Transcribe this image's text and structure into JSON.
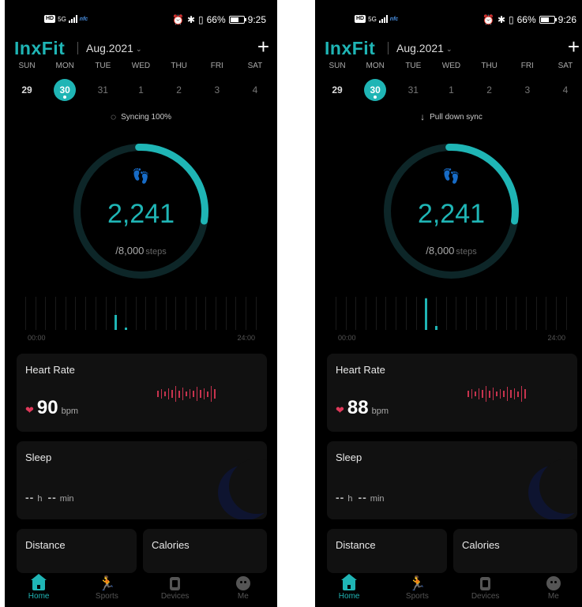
{
  "colors": {
    "accent": "#1fb5b5",
    "heart": "#e0395a",
    "background": "#000000",
    "card": "#111111"
  },
  "screens": [
    {
      "status": {
        "network": "5G",
        "battery": "66%",
        "time": "9:25"
      },
      "header": {
        "logo": "InxFit",
        "month": "Aug.2021",
        "add_icon": "plus-icon"
      },
      "week": [
        {
          "name": "SUN",
          "date": "29"
        },
        {
          "name": "MON",
          "date": "30"
        },
        {
          "name": "TUE",
          "date": "31"
        },
        {
          "name": "WED",
          "date": "1"
        },
        {
          "name": "THU",
          "date": "2"
        },
        {
          "name": "FRI",
          "date": "3"
        },
        {
          "name": "SAT",
          "date": "4"
        }
      ],
      "sync": {
        "icon": "syncing-spinner-icon",
        "text": "Syncing 100%"
      },
      "steps": {
        "value": "2,241",
        "goal": "/8,000",
        "unit": "steps",
        "progress_fraction": 0.28
      },
      "hourly": {
        "start": "00:00",
        "end": "24:00",
        "levels": [
          0,
          0,
          0,
          0,
          0,
          0,
          0,
          0,
          0,
          0.45,
          0.08,
          0,
          0,
          0,
          0,
          0,
          0,
          0,
          0,
          0,
          0,
          0,
          0,
          0
        ]
      },
      "heart_rate": {
        "title": "Heart Rate",
        "value": "90",
        "unit": "bpm"
      },
      "sleep": {
        "title": "Sleep",
        "hours": "--",
        "h": "h",
        "minutes": "--",
        "min": "min"
      },
      "distance": {
        "title": "Distance"
      },
      "calories": {
        "title": "Calories"
      },
      "nav": [
        {
          "label": "Home",
          "icon": "home-icon"
        },
        {
          "label": "Sports",
          "icon": "running-icon"
        },
        {
          "label": "Devices",
          "icon": "watch-icon"
        },
        {
          "label": "Me",
          "icon": "face-icon"
        }
      ]
    },
    {
      "status": {
        "network": "5G",
        "battery": "66%",
        "time": "9:26"
      },
      "header": {
        "logo": "InxFit",
        "month": "Aug.2021",
        "add_icon": "plus-icon"
      },
      "week": [
        {
          "name": "SUN",
          "date": "29"
        },
        {
          "name": "MON",
          "date": "30"
        },
        {
          "name": "TUE",
          "date": "31"
        },
        {
          "name": "WED",
          "date": "1"
        },
        {
          "name": "THU",
          "date": "2"
        },
        {
          "name": "FRI",
          "date": "3"
        },
        {
          "name": "SAT",
          "date": "4"
        }
      ],
      "sync": {
        "icon": "arrow-down-icon",
        "text": "Pull down sync"
      },
      "steps": {
        "value": "2,241",
        "goal": "/8,000",
        "unit": "steps",
        "progress_fraction": 0.28
      },
      "hourly": {
        "start": "00:00",
        "end": "24:00",
        "levels": [
          0,
          0,
          0,
          0,
          0,
          0,
          0,
          0,
          0,
          0.95,
          0.12,
          0,
          0,
          0,
          0,
          0,
          0,
          0,
          0,
          0,
          0,
          0,
          0,
          0
        ]
      },
      "heart_rate": {
        "title": "Heart Rate",
        "value": "88",
        "unit": "bpm"
      },
      "sleep": {
        "title": "Sleep",
        "hours": "--",
        "h": "h",
        "minutes": "--",
        "min": "min"
      },
      "distance": {
        "title": "Distance"
      },
      "calories": {
        "title": "Calories"
      },
      "nav": [
        {
          "label": "Home",
          "icon": "home-icon"
        },
        {
          "label": "Sports",
          "icon": "running-icon"
        },
        {
          "label": "Devices",
          "icon": "watch-icon"
        },
        {
          "label": "Me",
          "icon": "face-icon"
        }
      ]
    }
  ]
}
